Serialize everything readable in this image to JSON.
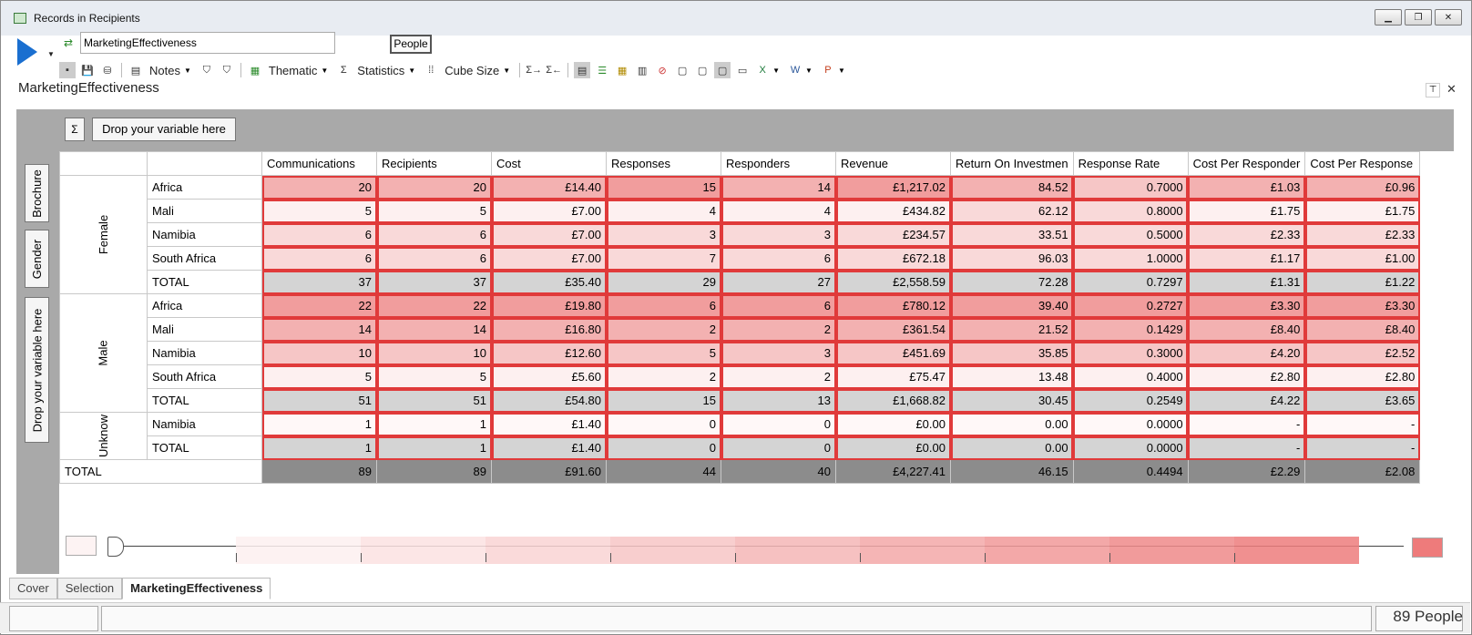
{
  "window": {
    "title": "Records in Recipients"
  },
  "toolbar": {
    "name_value": "MarketingEffectiveness",
    "people_label": "People",
    "notes_label": "Notes",
    "thematic_label": "Thematic",
    "statistics_label": "Statistics",
    "cube_size_label": "Cube Size"
  },
  "heading": "MarketingEffectiveness",
  "drop_column": "Drop your variable here",
  "sigma": "Σ",
  "side": {
    "brochure": "Brochure",
    "gender": "Gender",
    "drop_row": "Drop your variable here"
  },
  "columns": [
    "Communications",
    "Recipients",
    "Cost",
    "Responses",
    "Responders",
    "Revenue",
    "Return On Investmen",
    "Response Rate",
    "Cost Per Responder",
    "Cost Per Response"
  ],
  "groups": [
    {
      "name": "Female",
      "rows": [
        {
          "label": "Africa",
          "values": [
            "20",
            "20",
            "£14.40",
            "15",
            "14",
            "£1,217.02",
            "84.52",
            "0.7000",
            "£1.03",
            "£0.96"
          ]
        },
        {
          "label": "Mali",
          "values": [
            "5",
            "5",
            "£7.00",
            "4",
            "4",
            "£434.82",
            "62.12",
            "0.8000",
            "£1.75",
            "£1.75"
          ]
        },
        {
          "label": "Namibia",
          "values": [
            "6",
            "6",
            "£7.00",
            "3",
            "3",
            "£234.57",
            "33.51",
            "0.5000",
            "£2.33",
            "£2.33"
          ]
        },
        {
          "label": "South Africa",
          "values": [
            "6",
            "6",
            "£7.00",
            "7",
            "6",
            "£672.18",
            "96.03",
            "1.0000",
            "£1.17",
            "£1.00"
          ]
        },
        {
          "label": "TOTAL",
          "values": [
            "37",
            "37",
            "£35.40",
            "29",
            "27",
            "£2,558.59",
            "72.28",
            "0.7297",
            "£1.31",
            "£1.22"
          ]
        }
      ]
    },
    {
      "name": "Male",
      "rows": [
        {
          "label": "Africa",
          "values": [
            "22",
            "22",
            "£19.80",
            "6",
            "6",
            "£780.12",
            "39.40",
            "0.2727",
            "£3.30",
            "£3.30"
          ]
        },
        {
          "label": "Mali",
          "values": [
            "14",
            "14",
            "£16.80",
            "2",
            "2",
            "£361.54",
            "21.52",
            "0.1429",
            "£8.40",
            "£8.40"
          ]
        },
        {
          "label": "Namibia",
          "values": [
            "10",
            "10",
            "£12.60",
            "5",
            "3",
            "£451.69",
            "35.85",
            "0.3000",
            "£4.20",
            "£2.52"
          ]
        },
        {
          "label": "South Africa",
          "values": [
            "5",
            "5",
            "£5.60",
            "2",
            "2",
            "£75.47",
            "13.48",
            "0.4000",
            "£2.80",
            "£2.80"
          ]
        },
        {
          "label": "TOTAL",
          "values": [
            "51",
            "51",
            "£54.80",
            "15",
            "13",
            "£1,668.82",
            "30.45",
            "0.2549",
            "£4.22",
            "£3.65"
          ]
        }
      ]
    },
    {
      "name": "Unknow",
      "rows": [
        {
          "label": "Namibia",
          "values": [
            "1",
            "1",
            "£1.40",
            "0",
            "0",
            "£0.00",
            "0.00",
            "0.0000",
            "-",
            "-"
          ]
        },
        {
          "label": "TOTAL",
          "values": [
            "1",
            "1",
            "£1.40",
            "0",
            "0",
            "£0.00",
            "0.00",
            "0.0000",
            "-",
            "-"
          ]
        }
      ]
    }
  ],
  "grand_total": {
    "label": "TOTAL",
    "values": [
      "89",
      "89",
      "£91.60",
      "44",
      "40",
      "£4,227.41",
      "46.15",
      "0.4494",
      "£2.29",
      "£2.08"
    ]
  },
  "tabs": [
    "Cover",
    "Selection",
    "MarketingEffectiveness"
  ],
  "status": {
    "count": "89 People"
  },
  "colors": {
    "accent": "#1a6fd0",
    "heat_low": "#fdf0f0",
    "heat_high": "#ee7b7b",
    "highlight": "#e03a3a"
  }
}
